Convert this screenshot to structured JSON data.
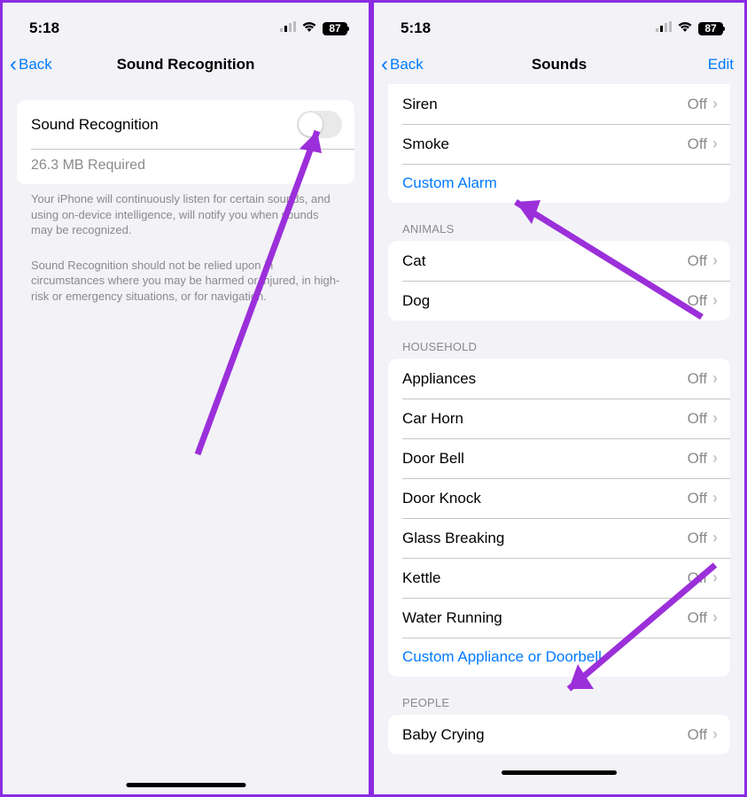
{
  "status": {
    "time": "5:18",
    "battery": "87"
  },
  "left": {
    "nav": {
      "back": "Back",
      "title": "Sound Recognition"
    },
    "toggle_label": "Sound Recognition",
    "storage": "26.3 MB Required",
    "footer1": "Your iPhone will continuously listen for certain sounds, and using on-device intelligence, will notify you when sounds may be recognized.",
    "footer2": "Sound Recognition should not be relied upon in circumstances where you may be harmed or injured, in high-risk or emergency situations, or for navigation."
  },
  "right": {
    "nav": {
      "back": "Back",
      "title": "Sounds",
      "edit": "Edit"
    },
    "value_off": "Off",
    "alarms": {
      "items": [
        "Siren",
        "Smoke"
      ],
      "custom": "Custom Alarm"
    },
    "animals": {
      "header": "ANIMALS",
      "items": [
        "Cat",
        "Dog"
      ]
    },
    "household": {
      "header": "HOUSEHOLD",
      "items": [
        "Appliances",
        "Car Horn",
        "Door Bell",
        "Door Knock",
        "Glass Breaking",
        "Kettle",
        "Water Running"
      ],
      "custom": "Custom Appliance or Doorbell"
    },
    "people": {
      "header": "PEOPLE",
      "items": [
        "Baby Crying"
      ]
    }
  }
}
